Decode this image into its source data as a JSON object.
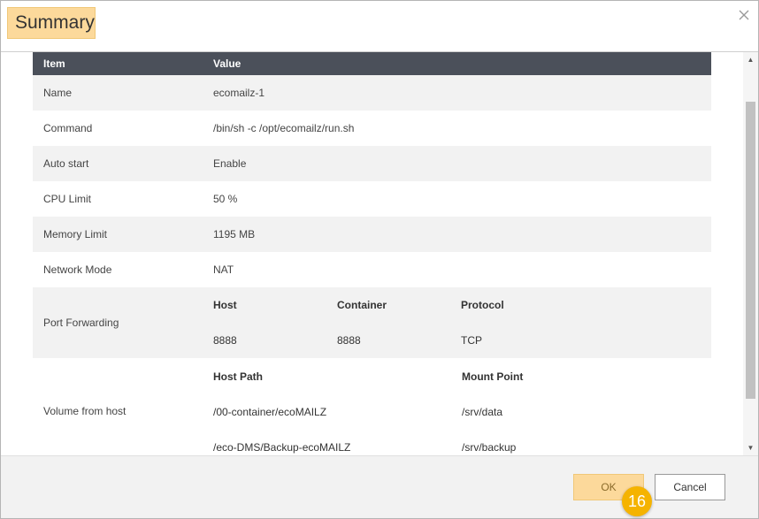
{
  "dialog": {
    "title": "Summary",
    "close_icon": "close-icon"
  },
  "table": {
    "headers": {
      "item": "Item",
      "value": "Value"
    },
    "rows": [
      {
        "key": "Name",
        "value": "ecomailz-1"
      },
      {
        "key": "Command",
        "value": "/bin/sh -c /opt/ecomailz/run.sh"
      },
      {
        "key": "Auto start",
        "value": "Enable"
      },
      {
        "key": "CPU Limit",
        "value": "50 %"
      },
      {
        "key": "Memory Limit",
        "value": "1195 MB"
      },
      {
        "key": "Network Mode",
        "value": "NAT"
      }
    ],
    "port_forwarding": {
      "key": "Port Forwarding",
      "headers": {
        "host": "Host",
        "container": "Container",
        "protocol": "Protocol"
      },
      "entries": [
        {
          "host": "8888",
          "container": "8888",
          "protocol": "TCP"
        }
      ]
    },
    "volume": {
      "key": "Volume from host",
      "headers": {
        "host_path": "Host Path",
        "mount_point": "Mount Point"
      },
      "entries": [
        {
          "host_path": "/00-container/ecoMAILZ",
          "mount_point": "/srv/data"
        },
        {
          "host_path": "/eco-DMS/Backup-ecoMAILZ",
          "mount_point": "/srv/backup"
        }
      ]
    }
  },
  "footer": {
    "ok_label": "OK",
    "cancel_label": "Cancel",
    "step_badge": "16"
  },
  "colors": {
    "accent": "#fcd99b",
    "header_bg": "#4b505a",
    "badge": "#f5b300"
  }
}
